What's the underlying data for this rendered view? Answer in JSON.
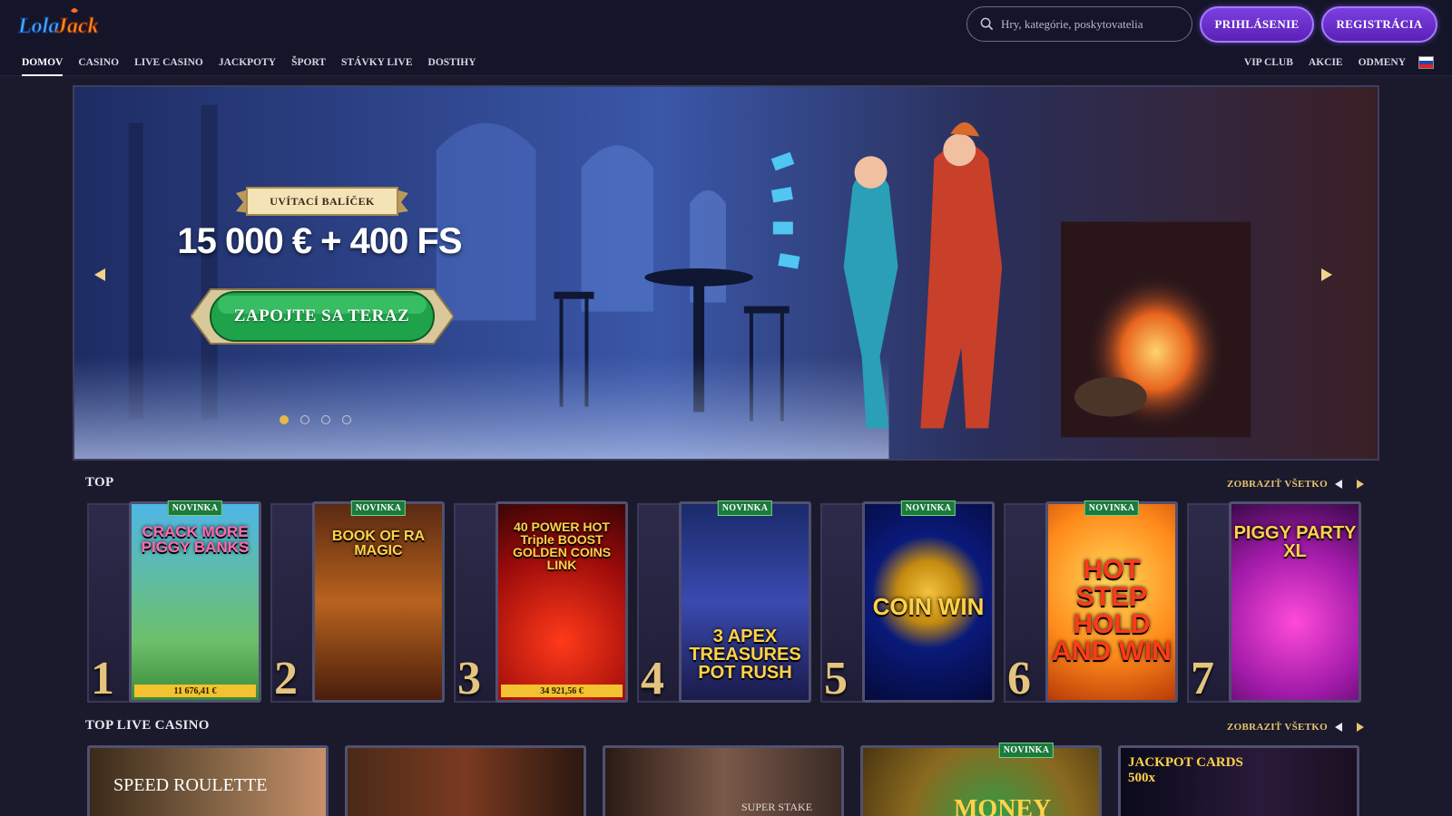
{
  "brand": {
    "logo_text": "LolaJack"
  },
  "header": {
    "search_placeholder": "Hry, kategórie, poskytovatelia",
    "login_label": "PRIHLÁSENIE",
    "register_label": "REGISTRÁCIA"
  },
  "nav": {
    "left": [
      "DOMOV",
      "CASINO",
      "LIVE CASINO",
      "JACKPOTY",
      "ŠPORT",
      "STÁVKY LIVE",
      "DOSTIHY"
    ],
    "right": [
      "VIP CLUB",
      "AKCIE",
      "ODMENY"
    ],
    "active": "DOMOV"
  },
  "hero": {
    "ribbon": "UVÍTACÍ BALÍČEK",
    "amount": "15 000 € + 400 FS",
    "cta": "ZAPOJTE SA TERAZ",
    "slides": 4,
    "active_slide": 1
  },
  "top": {
    "title": "TOP",
    "show_all": "ZOBRAZIŤ VŠETKO",
    "badge": "NOVINKA",
    "games": [
      {
        "rank": "1",
        "name": "CRACK MORE PIGGY BANKS",
        "new": true,
        "jackpot": "11 676,41 €"
      },
      {
        "rank": "2",
        "name": "BOOK OF RA MAGIC",
        "new": true,
        "jackpot": ""
      },
      {
        "rank": "3",
        "name": "40 POWER HOT Triple BOOST GOLDEN COINS LINK",
        "new": false,
        "jackpot": "34 921,56 €"
      },
      {
        "rank": "4",
        "name": "3 APEX TREASURES POT RUSH",
        "new": true,
        "jackpot": ""
      },
      {
        "rank": "5",
        "name": "COIN WIN",
        "new": true,
        "jackpot": ""
      },
      {
        "rank": "6",
        "name": "HOT STEP HOLD AND WIN",
        "new": true,
        "jackpot": ""
      },
      {
        "rank": "7",
        "name": "PIGGY PARTY XL",
        "new": false,
        "jackpot": ""
      }
    ]
  },
  "live": {
    "title": "TOP LIVE CASINO",
    "show_all": "ZOBRAZIŤ VŠETKO",
    "cards": [
      {
        "label": "SPEED ROULETTE",
        "new": false
      },
      {
        "label": "",
        "new": false
      },
      {
        "label": "SUPER STAKE",
        "new": false
      },
      {
        "label": "MONEY",
        "new": true
      },
      {
        "label": "JACKPOT CARDS 500x",
        "new": false
      }
    ]
  },
  "colors": {
    "accent": "#7c3fe0",
    "gold": "#e6c46e",
    "bg": "#1a1a2c",
    "badge": "#1b7a3c"
  }
}
